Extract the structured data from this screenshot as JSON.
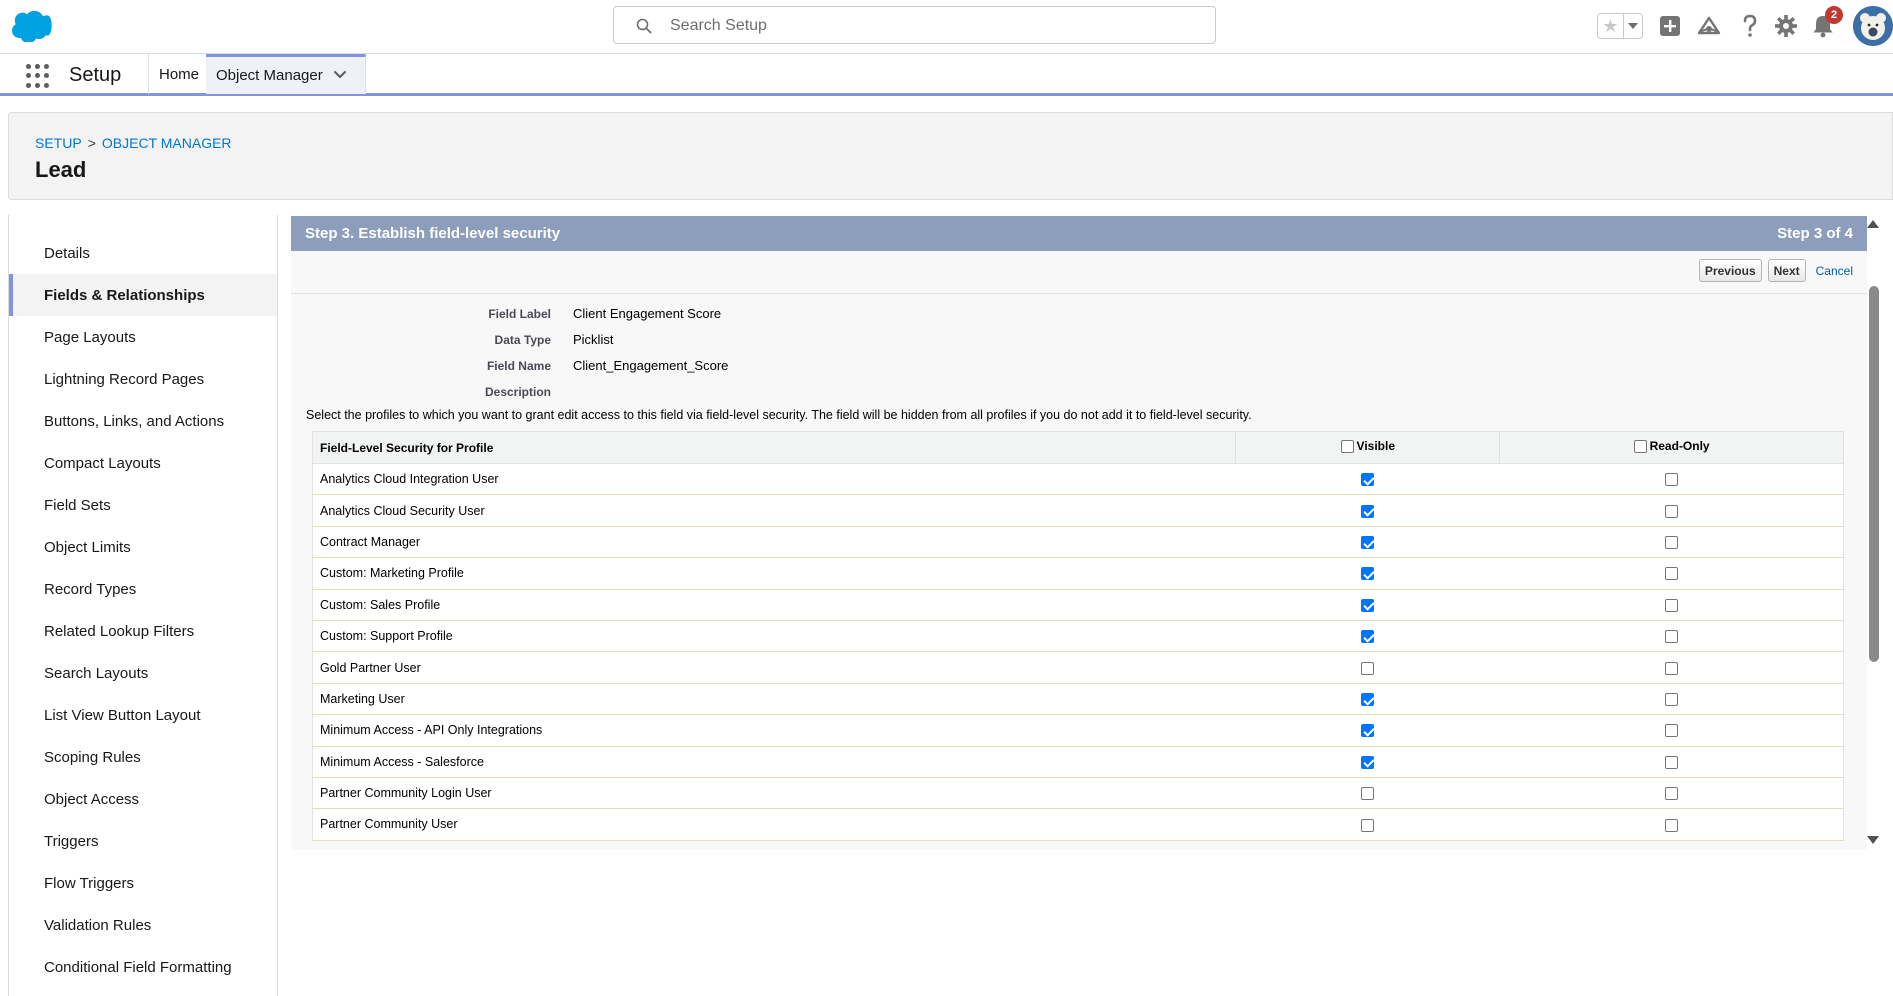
{
  "search": {
    "placeholder": "Search Setup"
  },
  "header": {
    "notification_count": "2"
  },
  "app_nav": {
    "app_name": "Setup",
    "tabs": [
      {
        "label": "Home"
      },
      {
        "label": "Object Manager"
      }
    ]
  },
  "page": {
    "breadcrumb": [
      "SETUP",
      "OBJECT MANAGER"
    ],
    "breadcrumb_separator": ">",
    "title": "Lead"
  },
  "sidebar": {
    "items": [
      {
        "label": "Details"
      },
      {
        "label": "Fields & Relationships"
      },
      {
        "label": "Page Layouts"
      },
      {
        "label": "Lightning Record Pages"
      },
      {
        "label": "Buttons, Links, and Actions"
      },
      {
        "label": "Compact Layouts"
      },
      {
        "label": "Field Sets"
      },
      {
        "label": "Object Limits"
      },
      {
        "label": "Record Types"
      },
      {
        "label": "Related Lookup Filters"
      },
      {
        "label": "Search Layouts"
      },
      {
        "label": "List View Button Layout"
      },
      {
        "label": "Scoping Rules"
      },
      {
        "label": "Object Access"
      },
      {
        "label": "Triggers"
      },
      {
        "label": "Flow Triggers"
      },
      {
        "label": "Validation Rules"
      },
      {
        "label": "Conditional Field Formatting"
      }
    ],
    "active_index": 1
  },
  "step": {
    "title": "Step 3. Establish field-level security",
    "progress": "Step 3 of 4",
    "buttons": {
      "previous": "Previous",
      "next": "Next",
      "cancel": "Cancel"
    }
  },
  "field_details": [
    {
      "label": "Field Label",
      "value": "Client Engagement Score"
    },
    {
      "label": "Data Type",
      "value": "Picklist"
    },
    {
      "label": "Field Name",
      "value": "Client_Engagement_Score"
    },
    {
      "label": "Description",
      "value": ""
    }
  ],
  "instructions": "Select the profiles to which you want to grant edit access to this field via field-level security. The field will be hidden from all profiles if you do not add it to field-level security.",
  "fls_table": {
    "headers": {
      "profile": "Field-Level Security for Profile",
      "visible": "Visible",
      "read_only": "Read-Only"
    },
    "header_visible_checked": false,
    "header_read_only_checked": false,
    "rows": [
      {
        "profile": "Analytics Cloud Integration User",
        "visible": true,
        "read_only": false
      },
      {
        "profile": "Analytics Cloud Security User",
        "visible": true,
        "read_only": false
      },
      {
        "profile": "Contract Manager",
        "visible": true,
        "read_only": false
      },
      {
        "profile": "Custom: Marketing Profile",
        "visible": true,
        "read_only": false
      },
      {
        "profile": "Custom: Sales Profile",
        "visible": true,
        "read_only": false
      },
      {
        "profile": "Custom: Support Profile",
        "visible": true,
        "read_only": false
      },
      {
        "profile": "Gold Partner User",
        "visible": false,
        "read_only": false
      },
      {
        "profile": "Marketing User",
        "visible": true,
        "read_only": false
      },
      {
        "profile": "Minimum Access - API Only Integrations",
        "visible": true,
        "read_only": false
      },
      {
        "profile": "Minimum Access - Salesforce",
        "visible": true,
        "read_only": false
      },
      {
        "profile": "Partner Community Login User",
        "visible": false,
        "read_only": false
      },
      {
        "profile": "Partner Community User",
        "visible": false,
        "read_only": false
      }
    ]
  },
  "colors": {
    "brand": "#00a1e0",
    "step_header": "#8d9ebc",
    "nav_accent": "#8094e0",
    "link": "#0176d3",
    "checkbox_on": "#0075ff",
    "badge": "#c23934"
  },
  "icons": {
    "logo": "salesforce-cloud-logo",
    "search": "search-icon",
    "favorites": "star-icon",
    "add": "plus-icon",
    "trailhead": "trailhead-icon",
    "help": "question-icon",
    "settings": "gear-icon",
    "notifications": "bell-icon",
    "app_launcher": "waffle-icon"
  }
}
